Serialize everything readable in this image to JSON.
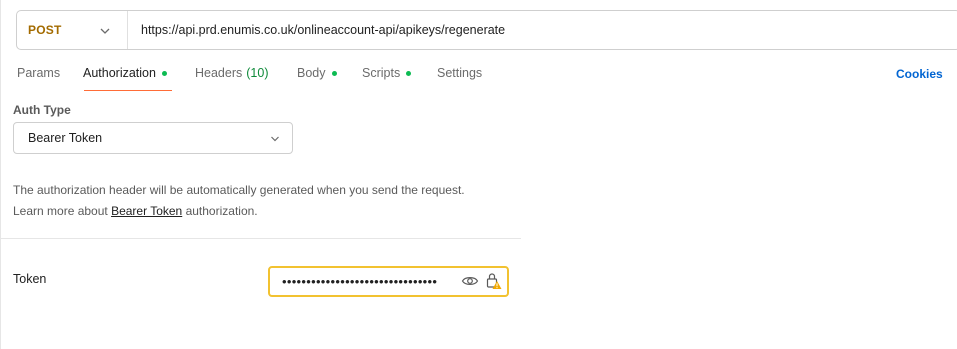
{
  "request": {
    "method": "POST",
    "url": "https://api.prd.enumis.co.uk/onlineaccount-api/apikeys/regenerate"
  },
  "tabs": [
    {
      "label": "Params",
      "dot": false,
      "count": ""
    },
    {
      "label": "Authorization",
      "dot": true,
      "count": "",
      "active": true
    },
    {
      "label": "Headers",
      "dot": false,
      "count": "(10)"
    },
    {
      "label": "Body",
      "dot": true,
      "count": ""
    },
    {
      "label": "Scripts",
      "dot": true,
      "count": ""
    },
    {
      "label": "Settings",
      "dot": false,
      "count": ""
    }
  ],
  "cookies_label": "Cookies",
  "auth": {
    "type_label": "Auth Type",
    "type_value": "Bearer Token",
    "description_line1": "The authorization header will be automatically generated when you send the request.",
    "description_prefix": "Learn more about",
    "description_link": "Bearer Token",
    "description_suffix": "authorization.",
    "token_label": "Token",
    "token_value_masked": "••••••••••••••••••••••••••••••••"
  },
  "colors": {
    "method": "#a36b00",
    "active_underline": "#ff6c37",
    "status_dot": "#0cbb52",
    "cookies_link": "#0265d2",
    "token_border_warning": "#f2c230"
  },
  "icons": {
    "method_dropdown": "chevron-down-icon",
    "auth_dropdown": "chevron-down-icon",
    "reveal_token": "eye-icon",
    "vault": "lock-warning-icon"
  }
}
